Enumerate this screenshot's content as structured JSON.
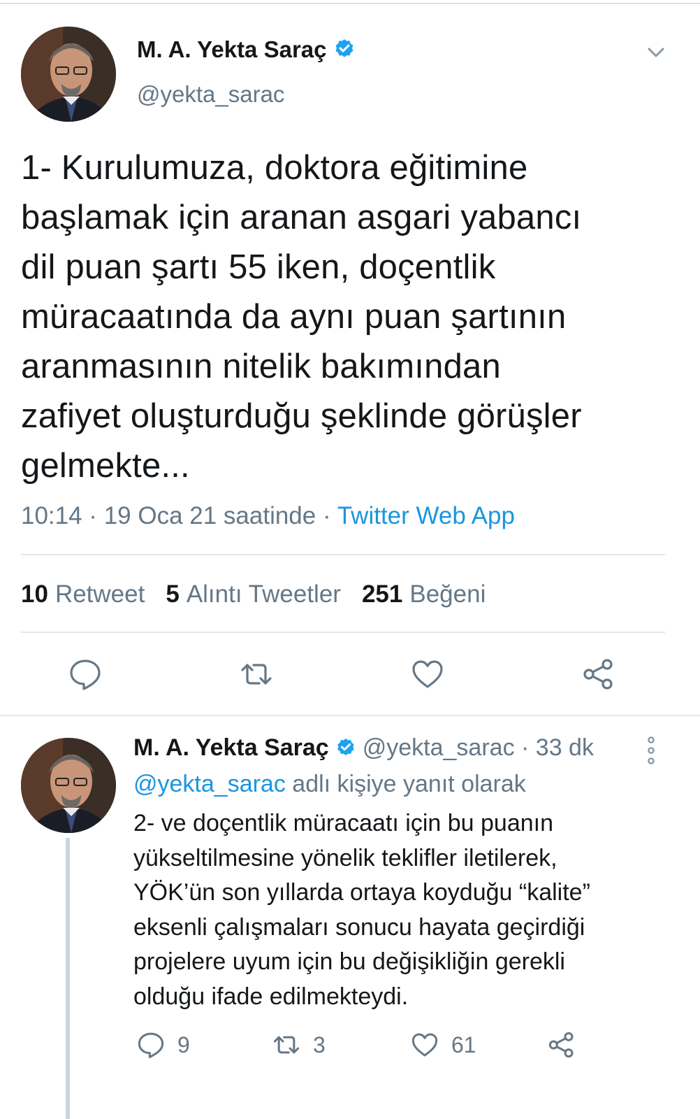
{
  "main_tweet": {
    "author_name": "M. A. Yekta Saraç",
    "handle": "@yekta_sarac",
    "text": "1- Kurulumuza, doktora eğitimine\nbaşlamak için aranan asgari yabancı\ndil puan şartı 55 iken, doçentlik\nmüracaatında da aynı puan şartının\naranmasının nitelik bakımından\nzafiyet oluşturduğu şeklinde görüşler\ngelmekte...",
    "timestamp": "10:14 · 19 Oca 21 saatinde · ",
    "source": "Twitter Web App",
    "stats": {
      "retweets_count": "10",
      "retweets_label": "Retweet",
      "quotes_count": "5",
      "quotes_label": "Alıntı Tweetler",
      "likes_count": "251",
      "likes_label": "Beğeni"
    }
  },
  "reply_tweet": {
    "author_name": "M. A. Yekta Saraç",
    "handle_time": "@yekta_sarac · 33 dk",
    "reply_to_mention": "@yekta_sarac",
    "reply_to_suffix": " adlı kişiye yanıt olarak",
    "text": "2- ve doçentlik müracaatı için bu puanın\nyükseltilmesine yönelik teklifler iletilerek,\nYÖK’ün son yıllarda ortaya koyduğu “kalite”\neksenli çalışmaları sonucu hayata geçirdiği\nprojelere uyum için bu değişikliğin gerekli\nolduğu ifade edilmekteydi.",
    "replies": "9",
    "retweets": "3",
    "likes": "61"
  },
  "colors": {
    "text": "#14171a",
    "secondary": "#657786",
    "link": "#1b95e0",
    "verified": "#1da1f2",
    "divider": "#e1e8ed"
  },
  "icons": [
    "chevron-down-icon",
    "verified-badge-icon",
    "reply-icon",
    "retweet-icon",
    "like-icon",
    "share-icon",
    "more-options-icon"
  ]
}
